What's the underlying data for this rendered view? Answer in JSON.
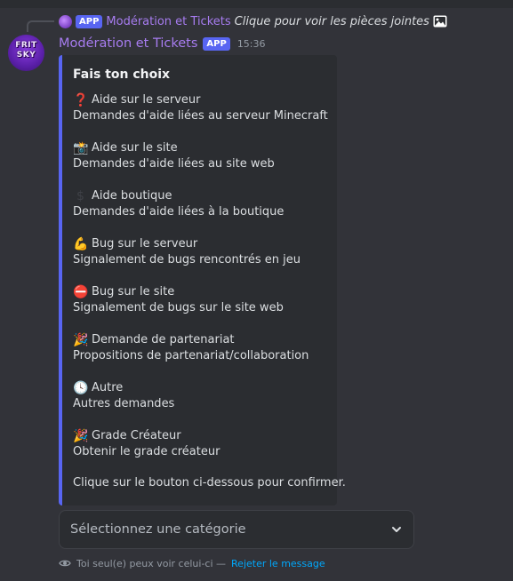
{
  "reply": {
    "app_badge": "APP",
    "author": "Modération et Tickets",
    "content": "Clique pour voir les pièces jointes"
  },
  "message": {
    "avatar_text": [
      "FRIT",
      "SKY"
    ],
    "author": "Modération et Tickets",
    "app_badge": "APP",
    "timestamp": "15:36"
  },
  "embed": {
    "accent_color": "#5865f2",
    "title": "Fais ton choix",
    "choices": [
      {
        "emoji": "❓",
        "icon": "question-icon",
        "label": "Aide sur le serveur",
        "description": "Demandes d'aide liées au serveur Minecraft"
      },
      {
        "emoji": "📸",
        "icon": "camera-icon",
        "label": "Aide sur le site",
        "description": "Demandes d'aide liées au site web"
      },
      {
        "emoji": "$",
        "icon": "dollar-icon",
        "label": "Aide boutique",
        "description": "Demandes d'aide liées à la boutique"
      },
      {
        "emoji": "💪",
        "icon": "flexed-biceps-icon",
        "label": "Bug sur le serveur",
        "description": "Signalement de bugs rencontrés en jeu"
      },
      {
        "emoji": "⛔",
        "icon": "stop-sign-icon",
        "label": "Bug sur le site",
        "description": "Signalement de bugs sur le site web"
      },
      {
        "emoji": "🎉",
        "icon": "party-popper-icon",
        "label": "Demande de partenariat",
        "description": "Propositions de partenariat/collaboration"
      },
      {
        "emoji": "🕓",
        "icon": "clock-icon",
        "label": "Autre",
        "description": "Autres demandes"
      },
      {
        "emoji": "🎉",
        "icon": "party-popper-icon",
        "label": "Grade Créateur",
        "description": "Obtenir le grade créateur"
      }
    ],
    "footer": "Clique sur le bouton ci-dessous pour confirmer."
  },
  "select": {
    "placeholder": "Sélectionnez une catégorie"
  },
  "ephemeral": {
    "notice": "Toi seul(e) peux voir celui-ci —",
    "dismiss": "Rejeter le message"
  },
  "colors": {
    "background": "#323339",
    "embed_bg": "#2b2d31",
    "author": "#a77cf0",
    "link": "#00a8fc",
    "badge": "#5865f2"
  }
}
